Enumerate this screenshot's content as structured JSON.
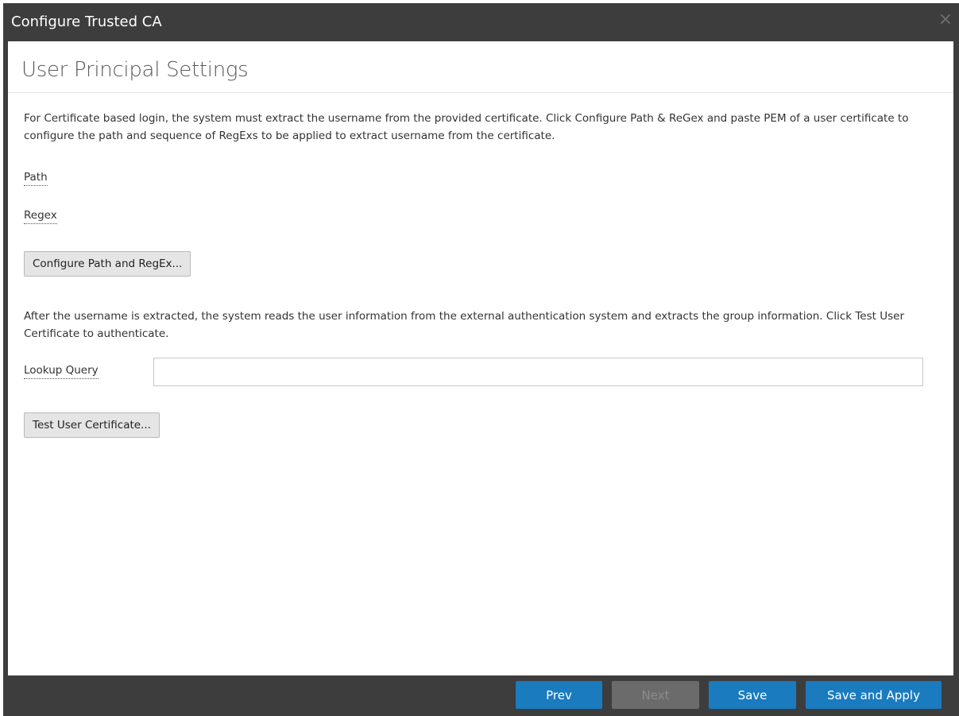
{
  "dialog": {
    "title": "Configure Trusted CA",
    "close_glyph": "×"
  },
  "section": {
    "title": "User Principal Settings",
    "description": "For Certificate based login, the system must extract the username from the provided certificate. Click Configure Path & ReGex and paste PEM of a user certificate to configure the path and sequence of RegExs to be applied to extract username from the certificate."
  },
  "fields": {
    "path_label": "Path",
    "regex_label": "Regex",
    "lookup_query_label": "Lookup Query",
    "lookup_query_value": ""
  },
  "buttons": {
    "configure_path_regex": "Configure Path and RegEx...",
    "test_user_certificate": "Test User Certificate..."
  },
  "group_description": "After the username is extracted, the system reads the user information from the external authentication system and extracts the group information. Click Test User Certificate to authenticate.",
  "footer": {
    "prev": "Prev",
    "next": "Next",
    "save": "Save",
    "save_and_apply": "Save and Apply"
  },
  "colors": {
    "primary_button": "#1a7bbf",
    "dialog_chrome": "#3d3d3d",
    "disabled_button": "#6b6b6b"
  }
}
